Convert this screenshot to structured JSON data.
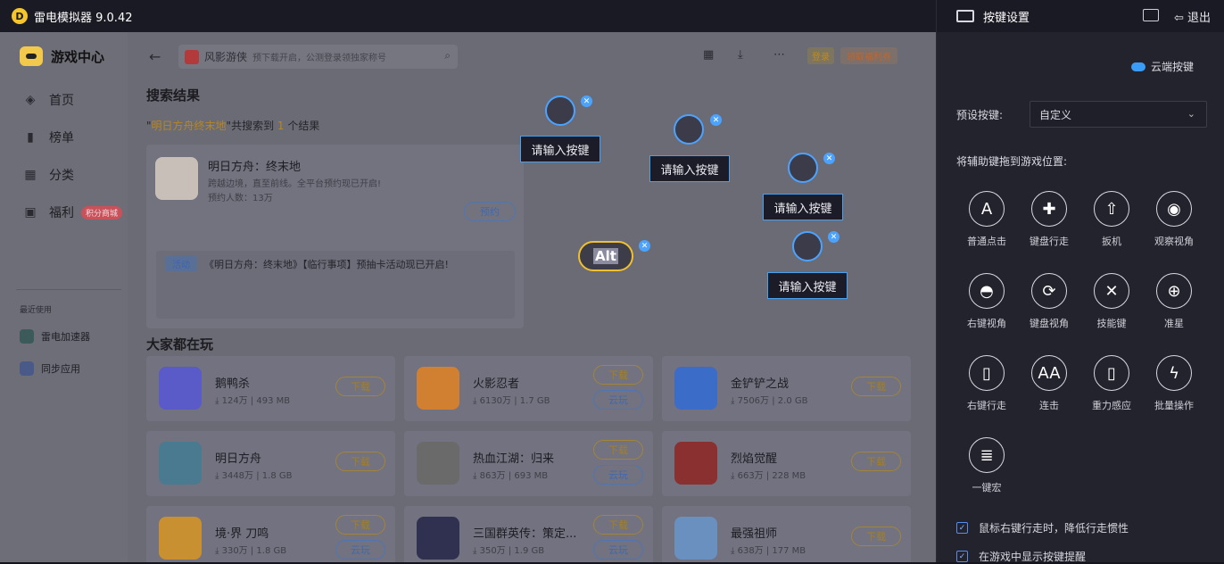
{
  "titlebar": {
    "title": "雷电模拟器 9.0.42",
    "logo_letter": "D"
  },
  "sidebar": {
    "brand": "游戏中心",
    "items": [
      {
        "label": "首页",
        "icon": "gamepad-icon"
      },
      {
        "label": "榜单",
        "icon": "bar-chart-icon"
      },
      {
        "label": "分类",
        "icon": "grid-icon"
      },
      {
        "label": "福利",
        "icon": "gift-icon",
        "badge": "积分商城"
      }
    ],
    "recent_title": "最近使用",
    "recent": [
      "雷电加速器",
      "同步应用"
    ]
  },
  "topbar": {
    "search_game": "风影游侠",
    "search_placeholder": "预下载开启，公测登录领独家称号",
    "login": "登录",
    "benefit": "领取福利券"
  },
  "search": {
    "title": "搜索结果",
    "q_open": "\"",
    "query": "明日方舟终末地",
    "q_close": "\"共搜索到",
    "count": "1",
    "suffix": "个结果",
    "result": {
      "name": "明日方舟：终末地",
      "desc": "跨越边境，直至前线。全平台预约现已开启!",
      "stat": "预约人数：13万",
      "button": "预约",
      "event_tag": "活动",
      "event_text": "《明日方舟：终末地》【临行事项】预抽卡活动现已开启!"
    }
  },
  "popular": {
    "title": "大家都在玩",
    "games": [
      {
        "name": "鹅鸭杀",
        "stat": "⤓ 124万 | 493 MB",
        "btn": "下载",
        "btn2": "",
        "color": "#5a5ac8"
      },
      {
        "name": "火影忍者",
        "stat": "⤓ 6130万 | 1.7 GB",
        "btn": "下载",
        "btn2": "云玩",
        "color": "#d08030"
      },
      {
        "name": "金铲铲之战",
        "stat": "⤓ 7506万 | 2.0 GB",
        "btn": "下载",
        "btn2": "",
        "color": "#3a6cc8"
      },
      {
        "name": "明日方舟",
        "stat": "⤓ 3448万 | 1.8 GB",
        "btn": "下载",
        "btn2": "",
        "color": "#4a7a90"
      },
      {
        "name": "热血江湖：归来",
        "stat": "⤓ 863万 | 693 MB",
        "btn": "下载",
        "btn2": "云玩",
        "color": "#6a6a6a"
      },
      {
        "name": "烈焰觉醒",
        "stat": "⤓ 663万 | 228 MB",
        "btn": "下载",
        "btn2": "",
        "color": "#8a3030"
      },
      {
        "name": "境·界 刀鸣",
        "stat": "⤓ 330万 | 1.8 GB",
        "btn": "下载",
        "btn2": "云玩",
        "color": "#c89030"
      },
      {
        "name": "三国群英传：策定...",
        "stat": "⤓ 350万 | 1.9 GB",
        "btn": "下载",
        "btn2": "云玩",
        "color": "#303050"
      },
      {
        "name": "最强祖师",
        "stat": "⤓ 638万 | 177 MB",
        "btn": "下载",
        "btn2": "",
        "color": "#6a90c0"
      }
    ]
  },
  "keypoints": {
    "label": "请输入按键",
    "alt": "Alt",
    "close": "✕"
  },
  "keyset": {
    "title": "按键设置",
    "exit": "⇦ 退出",
    "cloud": "云端按键",
    "preset_label": "预设按键:",
    "preset_value": "自定义",
    "drag_hint": "将辅助键拖到游戏位置:",
    "tools": [
      {
        "label": "普通点击",
        "glyph": "A"
      },
      {
        "label": "键盘行走",
        "glyph": "✚"
      },
      {
        "label": "扳机",
        "glyph": "⇧"
      },
      {
        "label": "观察视角",
        "glyph": "◉"
      },
      {
        "label": "右键视角",
        "glyph": "◓"
      },
      {
        "label": "键盘视角",
        "glyph": "⟳"
      },
      {
        "label": "技能键",
        "glyph": "✕"
      },
      {
        "label": "准星",
        "glyph": "⊕"
      },
      {
        "label": "右键行走",
        "glyph": "▯"
      },
      {
        "label": "连击",
        "glyph": "AA"
      },
      {
        "label": "重力感应",
        "glyph": "▯"
      },
      {
        "label": "批量操作",
        "glyph": "ϟ"
      },
      {
        "label": "一键宏",
        "glyph": "≣"
      }
    ],
    "checks": [
      "鼠标右键行走时，降低行走惯性",
      "在游戏中显示按键提醒"
    ]
  }
}
